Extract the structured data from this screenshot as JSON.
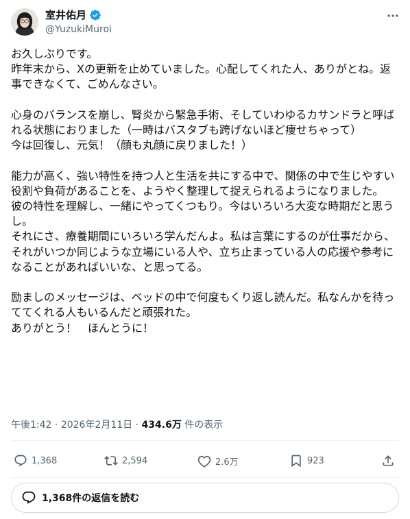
{
  "author": {
    "display_name": "室井佑月",
    "handle": "@YuzukiMuroi",
    "verified": true
  },
  "tweet": {
    "paragraphs": [
      [
        "お久しぶりです。",
        "昨年末から、Xの更新を止めていました。心配してくれた人、ありがとね。返事できなくて、ごめんなさい。"
      ],
      [
        "心身のバランスを崩し、腎炎から緊急手術、そしていわゆるカサンドラと呼ばれる状態におりました（一時はバスタブも跨げないほど痩せちゃって）",
        "今は回復し、元気！（顔も丸顔に戻りました！）"
      ],
      [
        "能力が高く、強い特性を持つ人と生活を共にする中で、関係の中で生じやすい役割や負荷があることを、ようやく整理して捉えられるようになりました。",
        "彼の特性を理解し、一緒にやってくつもり。今はいろいろ大変な時期だと思うし。",
        "それにさ、療養期間にいろいろ学んだんよ。私は言葉にするのが仕事だから、それがいつか同じような立場にいる人や、立ち止まっている人の応援や参考になることがあればいいな、と思ってる。"
      ],
      [
        "励ましのメッセージは、ベッドの中で何度もくり返し読んだ。私なんかを待っててくれる人もいるんだと頑張れた。",
        "ありがとう！　ほんとうに！"
      ]
    ]
  },
  "meta": {
    "time": "午後1:42",
    "separator": "·",
    "date": "2026年2月11日",
    "views_count": "434.6万",
    "views_label": "件の表示"
  },
  "actions": {
    "replies": "1,368",
    "reposts": "2,594",
    "likes": "2.6万",
    "bookmarks": "923"
  },
  "read_replies": {
    "label": "1,368件の返信を読む"
  },
  "colors": {
    "verified": "#1d9bf0",
    "text": "#0f1419",
    "secondary": "#536471",
    "border": "#cfd9de"
  },
  "icons": {
    "verified": "verified-badge-icon",
    "more": "more-dots-icon",
    "reply": "reply-bubble-icon",
    "repost": "repost-icon",
    "like": "heart-icon",
    "bookmark": "bookmark-icon",
    "share": "share-icon",
    "read_replies": "speech-bubble-icon"
  }
}
